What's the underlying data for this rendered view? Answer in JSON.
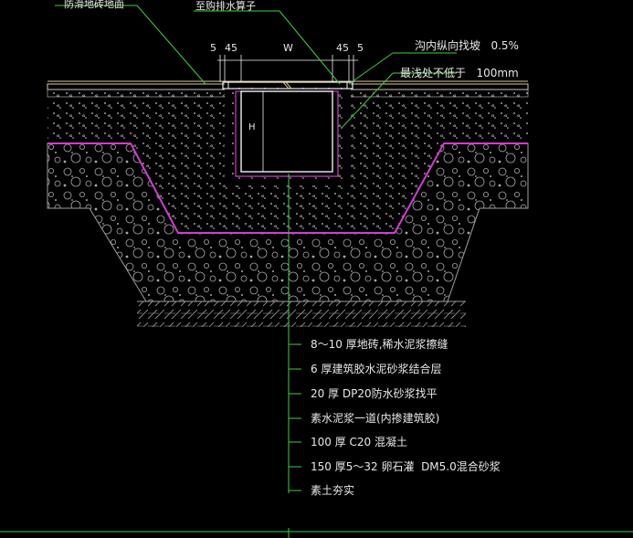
{
  "labels": {
    "top_left_callout": "防滑地砖地面",
    "top_mid_callout": "至购排水算子",
    "slope": "沟内纵向找坡   0.5%",
    "min_depth": "最浅处不低于   100mm",
    "h": "H"
  },
  "dimensions": [
    "5",
    "45",
    "W",
    "45",
    "5"
  ],
  "layers": [
    "8～10 厚地砖,稀水泥浆擦缝",
    "6 厚建筑胶水泥砂浆结合层",
    "20 厚 DP20防水砂浆找平",
    "素水泥浆一道(内掺建筑胶)",
    "100 厚 C20 混凝土",
    "150 厚5～32 卵石灌  DM5.0混合砂浆",
    "素土夯实"
  ],
  "colors": {
    "background": "#000000",
    "text": "#e8e8e8",
    "leader": "#3ecf3e",
    "magenta": "#d23cd2",
    "concrete": "#bdbdbd",
    "aggregate": "#a8a8a8",
    "soil": "#9a9a9a",
    "floor": "#d9c79a",
    "white": "#f0f0f0"
  }
}
